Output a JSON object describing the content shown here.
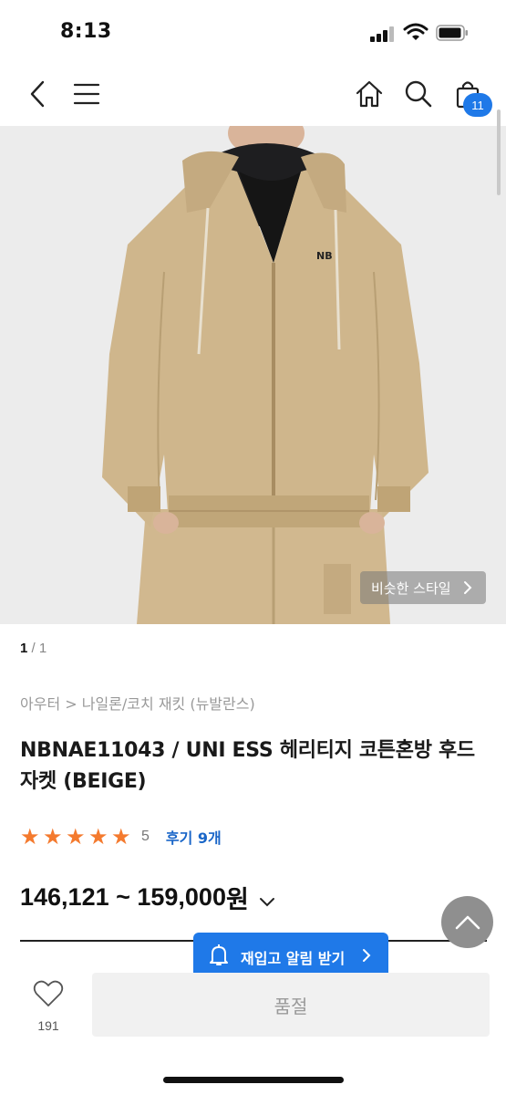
{
  "status_bar": {
    "time": "8:13"
  },
  "nav": {
    "icons": [
      "back-icon",
      "menu-icon",
      "home-icon",
      "search-icon",
      "shopping-bag-icon"
    ],
    "cart_count": "11"
  },
  "gallery": {
    "similar_style_label": "비슷한 스타일",
    "pager_current": "1",
    "pager_total": "/ 1"
  },
  "product": {
    "breadcrumb": "아우터 > 나일론/코치 재킷 (뉴발란스)",
    "title": "NBNAE11043 / UNI ESS 헤리티지 코튼혼방 후드 자켓 (BEIGE)",
    "rating_value": 5,
    "rating_label": "5",
    "reviews_label": "후기 9개",
    "price_range": "146,121 ~ 159,000",
    "price_unit": "원"
  },
  "colors": {
    "accent": "#1f79e8",
    "star": "#f47a2e",
    "review_link": "#1a66c8"
  },
  "actions": {
    "restock_label": "재입고 알림 받기",
    "wish_count": "191",
    "soldout_label": "품절"
  }
}
